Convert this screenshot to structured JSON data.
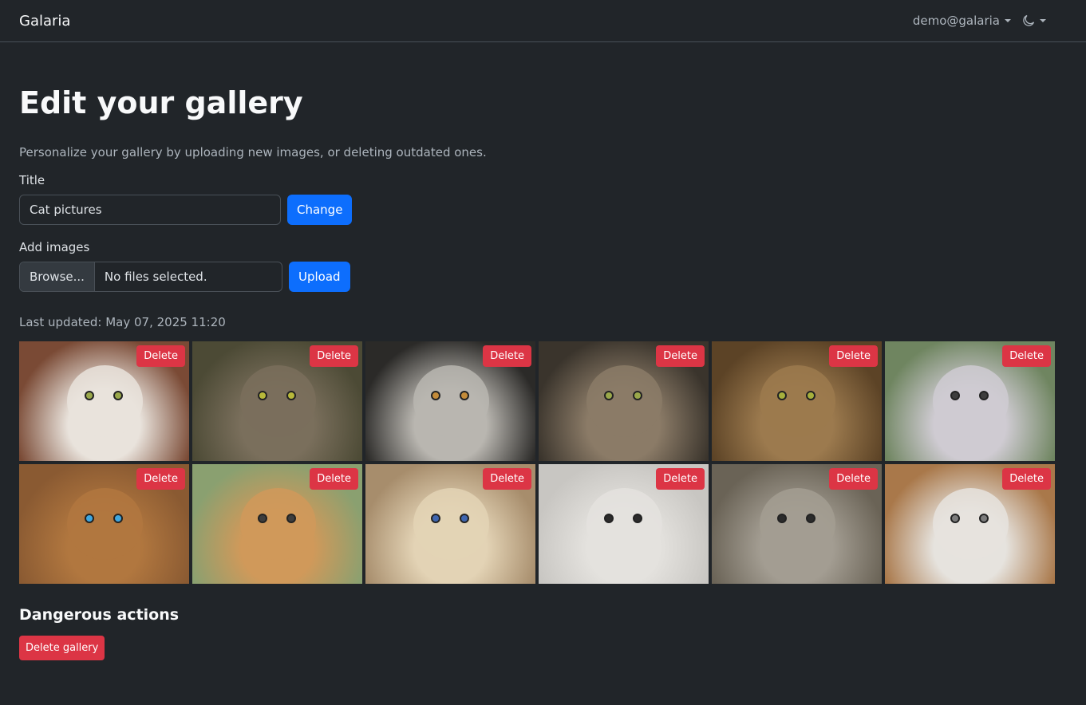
{
  "navbar": {
    "brand": "Galaria",
    "user": "demo@galaria"
  },
  "page": {
    "title": "Edit your gallery",
    "lead": "Personalize your gallery by uploading new images, or deleting outdated ones."
  },
  "title_form": {
    "label": "Title",
    "value": "Cat pictures",
    "button": "Change"
  },
  "upload_form": {
    "label": "Add images",
    "browse": "Browse...",
    "status": "No files selected.",
    "button": "Upload"
  },
  "last_updated": "Last updated: May 07, 2025 11:20",
  "gallery": {
    "delete_label": "Delete",
    "images": [
      {
        "name": "cat-image-1",
        "bg": "#7a4a35",
        "fur": "#e9e3dc",
        "eye": "#9aa84a"
      },
      {
        "name": "cat-image-2",
        "bg": "#4c4a35",
        "fur": "#7a6f5c",
        "eye": "#b8b93a"
      },
      {
        "name": "cat-image-3",
        "bg": "#2b2a28",
        "fur": "#b9b6b0",
        "eye": "#c48c3a"
      },
      {
        "name": "cat-image-4",
        "bg": "#3a342c",
        "fur": "#8b7b67",
        "eye": "#9aa84a"
      },
      {
        "name": "cat-image-5",
        "bg": "#5c4326",
        "fur": "#9c7a4e",
        "eye": "#a6b03c"
      },
      {
        "name": "cat-image-6",
        "bg": "#6f8560",
        "fur": "#cfcbd2",
        "eye": "#3d3d3d"
      },
      {
        "name": "cat-image-7",
        "bg": "#8a5a32",
        "fur": "#b1773f",
        "eye": "#3fa7e0"
      },
      {
        "name": "cat-image-8",
        "bg": "#8aa070",
        "fur": "#d0995a",
        "eye": "#3d3d3d"
      },
      {
        "name": "cat-image-9",
        "bg": "#a78d6c",
        "fur": "#e3d3b5",
        "eye": "#3f66b0"
      },
      {
        "name": "cat-image-10",
        "bg": "#c8c6c2",
        "fur": "#e4e2de",
        "eye": "#2b2b2b"
      },
      {
        "name": "cat-image-11",
        "bg": "#6a6356",
        "fur": "#a39d92",
        "eye": "#2b2b2b"
      },
      {
        "name": "cat-image-12",
        "bg": "#a9784a",
        "fur": "#e6e3de",
        "eye": "#7c7c7c"
      }
    ]
  },
  "danger": {
    "title": "Dangerous actions",
    "button": "Delete gallery"
  },
  "colors": {
    "primary": "#0d6efd",
    "danger": "#dc3545",
    "background": "#212529"
  }
}
